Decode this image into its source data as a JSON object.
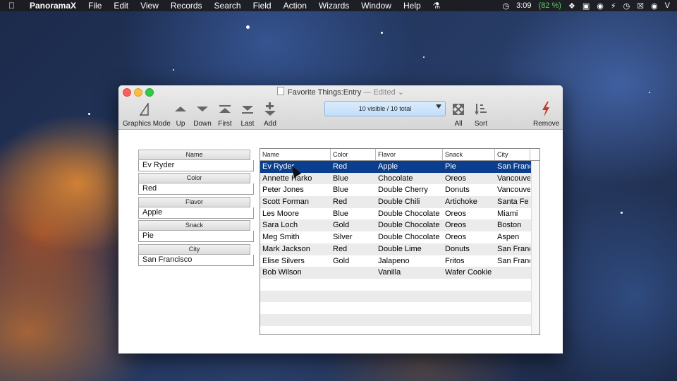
{
  "menubar": {
    "app": "PanoramaX",
    "items": [
      "File",
      "Edit",
      "View",
      "Records",
      "Search",
      "Field",
      "Action",
      "Wizards",
      "Window",
      "Help"
    ],
    "clock": "3:09",
    "battery": "(82 %)"
  },
  "window": {
    "title": "Favorite Things:Entry",
    "edited": "— Edited ⌄"
  },
  "toolbar": {
    "graphics_mode": "Graphics Mode",
    "up": "Up",
    "down": "Down",
    "first": "First",
    "last": "Last",
    "add": "Add",
    "visible": "10 visible / 10 total",
    "all": "All",
    "sort": "Sort",
    "remove": "Remove"
  },
  "form": {
    "name_label": "Name",
    "name_value": "Ev Ryder",
    "color_label": "Color",
    "color_value": "Red",
    "flavor_label": "Flavor",
    "flavor_value": "Apple",
    "snack_label": "Snack",
    "snack_value": "Pie",
    "city_label": "City",
    "city_value": "San Francisco"
  },
  "table": {
    "columns": [
      "Name",
      "Color",
      "Flavor",
      "Snack",
      "City"
    ],
    "rows": [
      [
        "Ev Ryder",
        "Red",
        "Apple",
        "Pie",
        "San Franc"
      ],
      [
        "Annette Harko",
        "Blue",
        "Chocolate",
        "Oreos",
        "Vancouve"
      ],
      [
        "Peter Jones",
        "Blue",
        "Double Cherry",
        "Donuts",
        "Vancouve"
      ],
      [
        "Scott Forman",
        "Red",
        "Double Chili",
        "Artichoke",
        "Santa Fe"
      ],
      [
        "Les Moore",
        "Blue",
        "Double Chocolate",
        "Oreos",
        "Miami"
      ],
      [
        "Sara Loch",
        "Gold",
        "Double Chocolate",
        "Oreos",
        "Boston"
      ],
      [
        "Meg Smith",
        "Silver",
        "Double Chocolate",
        "Oreos",
        "Aspen"
      ],
      [
        "Mark Jackson",
        "Red",
        "Double Lime",
        "Donuts",
        "San Franc"
      ],
      [
        "Elise Silvers",
        "Gold",
        "Jalapeno",
        "Fritos",
        "San Franc"
      ],
      [
        "Bob Wilson",
        "",
        "Vanilla",
        "Wafer Cookie",
        ""
      ],
      [
        "",
        "",
        "",
        "",
        ""
      ],
      [
        "",
        "",
        "",
        "",
        ""
      ],
      [
        "",
        "",
        "",
        "",
        ""
      ],
      [
        "",
        "",
        "",
        "",
        ""
      ]
    ]
  },
  "colors": {
    "selection": "#0b3e8e",
    "accent": "#c0392b"
  }
}
